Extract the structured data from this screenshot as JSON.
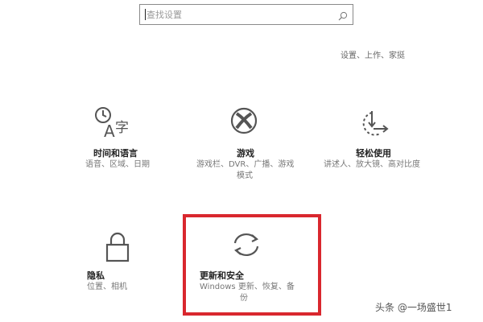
{
  "search": {
    "placeholder": "查找设置"
  },
  "profile_hint": "设置、上作、家挺",
  "tiles": [
    {
      "title": "时间和语言",
      "desc1": "语音、区域、日期",
      "desc2": ""
    },
    {
      "title": "游戏",
      "desc1": "游戏栏、DVR、广播、游戏",
      "desc2": "模式"
    },
    {
      "title": "轻松使用",
      "desc1": "讲述人、放大镜、高对比度",
      "desc2": ""
    },
    {
      "title": "隐私",
      "desc1": "位置、相机",
      "desc2": ""
    },
    {
      "title": "更新和安全",
      "desc1": "Windows 更新、恢复、备",
      "desc2": "份"
    }
  ],
  "watermark": "头条 @一场盛世1",
  "colors": {
    "highlight": "#d9272e",
    "icon": "#555555"
  }
}
